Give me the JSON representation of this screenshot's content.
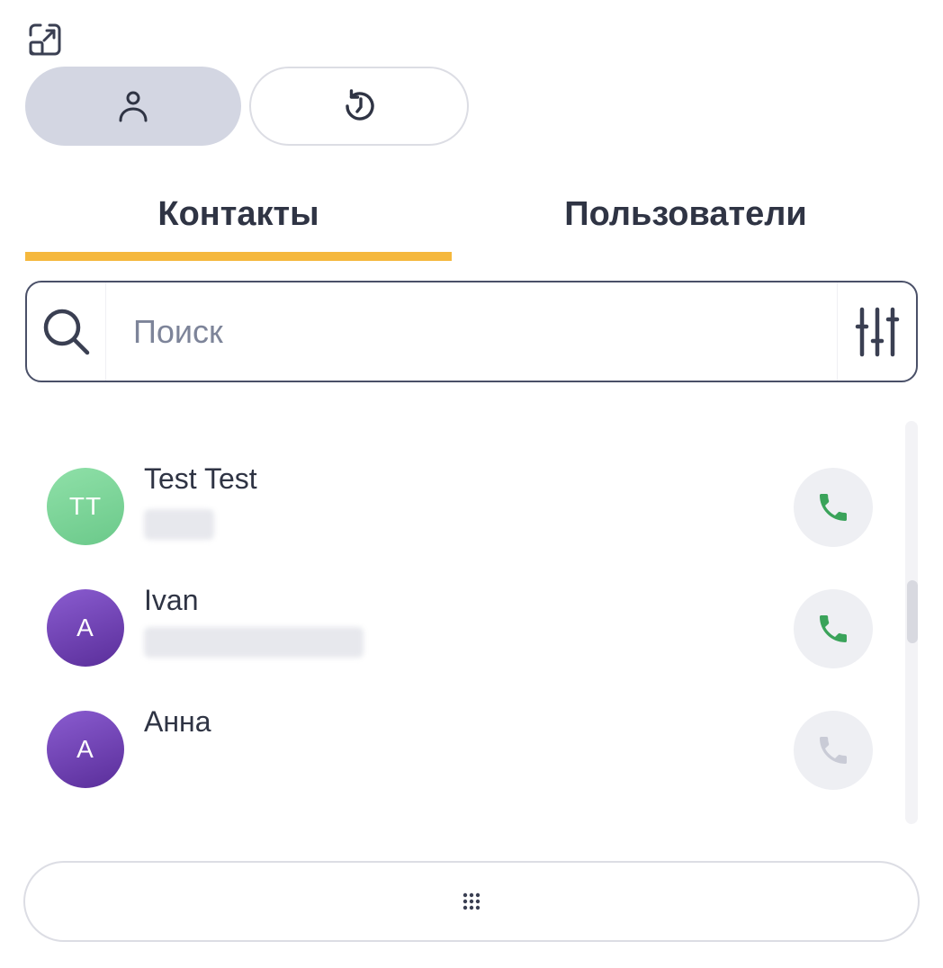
{
  "tabs": [
    {
      "label": "Контакты",
      "active": true
    },
    {
      "label": "Пользователи",
      "active": false
    }
  ],
  "search": {
    "placeholder": "Поиск",
    "value": ""
  },
  "contacts": [
    {
      "initials": "TT",
      "name": "Test Test",
      "avatar_color": "#7ed39a",
      "call_icon_color": "#3aa35a",
      "call_enabled": true
    },
    {
      "initials": "A",
      "name": "Ivan",
      "avatar_color": "#6b3fb0",
      "call_icon_color": "#3aa35a",
      "call_enabled": true
    },
    {
      "initials": "A",
      "name": "Анна",
      "avatar_color": "#6b3fb0",
      "call_icon_color": "#c9cbd6",
      "call_enabled": false
    }
  ],
  "icons": {
    "expand": "expand-icon",
    "contacts_mode": "person-icon",
    "history_mode": "history-icon",
    "search": "search-icon",
    "filter": "filter-sliders-icon",
    "call": "phone-icon",
    "dialpad": "dialpad-icon"
  },
  "colors": {
    "accent_underline": "#f5b83d",
    "active_mode_bg": "#d3d6e2",
    "text": "#2f3444",
    "placeholder": "#7d8499"
  }
}
